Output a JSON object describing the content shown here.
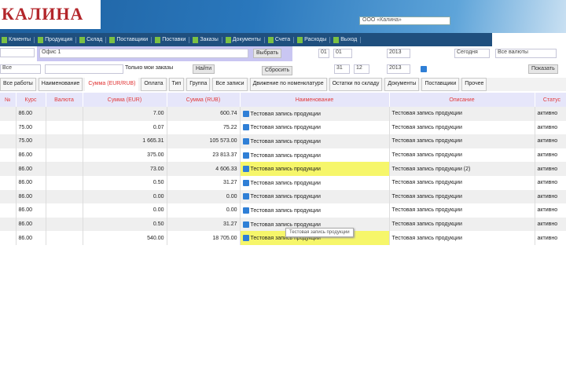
{
  "header": {
    "logo": "КАЛИНА",
    "selector": "ООО «Калина»"
  },
  "nav": [
    "Клиенты",
    "Продукция",
    "Склад",
    "Поставщики",
    "Поставки",
    "Заказы",
    "Документы",
    "Счета",
    "Расходы",
    "Выход"
  ],
  "filters": {
    "search": "",
    "company": "Офис 1",
    "apply": "Выбрать",
    "d1": "01",
    "d2": "01",
    "year": "2013",
    "p1": "Сегодня",
    "p2": "Все валюты",
    "kind": "Все",
    "check_label": "Только мои заказы",
    "find": "Найти",
    "reset": "Сбросить",
    "d3": "31",
    "d4": "12",
    "y2": "2013",
    "go": "Показать"
  },
  "tabs": [
    "Все работы",
    "Наименование",
    "Сумма (EUR/RUB)",
    "Оплата",
    "Тип",
    "Группа",
    "Все записи",
    "Движение по номенклатуре",
    "Остатки по складу",
    "Документы",
    "Поставщики",
    "Прочее"
  ],
  "active_tab": 2,
  "table": {
    "headers": [
      "№",
      "Курс",
      "Валюта",
      "Сумма (EUR)",
      "Сумма (RUB)",
      "Наименование",
      "Описание",
      "Статус"
    ],
    "rows": [
      [
        "",
        "86.00",
        "",
        "7.00",
        "600.74",
        "Тестовая запись продукции",
        "Тестовая запись продукции",
        "активно",
        false
      ],
      [
        "",
        "75.00",
        "",
        "0.07",
        "75.22",
        "Тестовая запись продукции",
        "Тестовая запись продукции",
        "активно",
        false
      ],
      [
        "",
        "75.00",
        "",
        "1 665.31",
        "105 573.00",
        "Тестовая запись продукции",
        "Тестовая запись продукции",
        "активно",
        false
      ],
      [
        "",
        "86.00",
        "",
        "375.00",
        "23 813.37",
        "Тестовая запись продукции",
        "Тестовая запись продукции",
        "активно",
        false
      ],
      [
        "",
        "86.00",
        "",
        "73.00",
        "4 606.33",
        "Тестовая запись продукции",
        "Тестовая запись продукции (2)",
        "активно",
        true
      ],
      [
        "",
        "86.00",
        "",
        "0.50",
        "31.27",
        "Тестовая запись продукции",
        "Тестовая запись продукции",
        "активно",
        false
      ],
      [
        "",
        "86.00",
        "",
        "0.00",
        "0.00",
        "Тестовая запись продукции",
        "Тестовая запись продукции",
        "активно",
        false
      ],
      [
        "",
        "86.00",
        "",
        "0.00",
        "0.00",
        "Тестовая запись продукции",
        "Тестовая запись продукции",
        "активно",
        false
      ],
      [
        "",
        "86.00",
        "",
        "0.50",
        "31.27",
        "Тестовая запись продукции",
        "Тестовая запись продукции",
        "активно",
        false
      ],
      [
        "",
        "86.00",
        "",
        "540.00",
        "18 705.00",
        "Тестовая запись продукции",
        "Тестовая запись продукции",
        "активно",
        true
      ]
    ]
  },
  "tooltip": "Тестовая запись продукции"
}
